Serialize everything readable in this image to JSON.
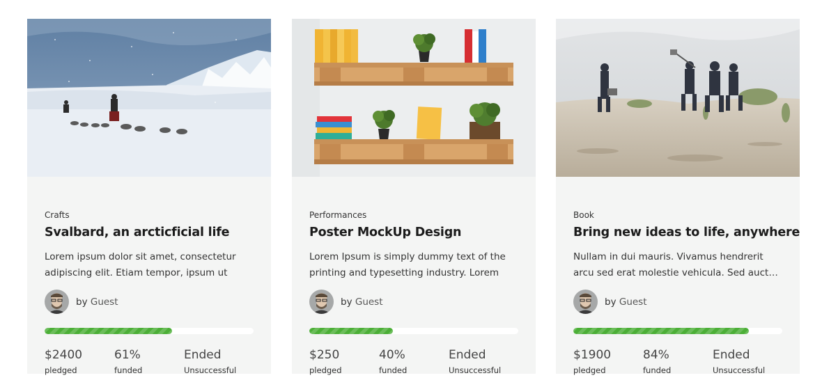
{
  "cards": [
    {
      "image": "dog-sled-snow-landscape",
      "category": "Crafts",
      "title": "Svalbard, an arcticficial life",
      "excerpt": "Lorem ipsum dolor sit amet, consectetur adipiscing elit. Etiam tempor, ipsum ut mattis",
      "author_prefix": "by",
      "author": "Guest",
      "progress_percent": 61,
      "stats": [
        {
          "value": "$2400",
          "label": "pledged"
        },
        {
          "value": "61%",
          "label": "funded"
        },
        {
          "value": "Ended",
          "label": "Unsuccessful"
        }
      ]
    },
    {
      "image": "pallet-shelves-books-plants",
      "category": "Performances",
      "title": "Poster MockUp Design",
      "excerpt": "Lorem Ipsum is simply dummy text of the printing and typesetting industry. Lorem Ipsum",
      "author_prefix": "by",
      "author": "Guest",
      "progress_percent": 40,
      "stats": [
        {
          "value": "$250",
          "label": "pledged"
        },
        {
          "value": "40%",
          "label": "funded"
        },
        {
          "value": "Ended",
          "label": "Unsuccessful"
        }
      ]
    },
    {
      "image": "film-crew-beach-dunes",
      "category": "Book",
      "title": "Bring new ideas to life, anywhere",
      "excerpt": "Nullam in dui mauris. Vivamus hendrerit arcu sed erat molestie vehicula. Sed auctor neque eu...",
      "author_prefix": "by",
      "author": "Guest",
      "progress_percent": 84,
      "stats": [
        {
          "value": "$1900",
          "label": "pledged"
        },
        {
          "value": "84%",
          "label": "funded"
        },
        {
          "value": "Ended",
          "label": "Unsuccessful"
        }
      ]
    }
  ],
  "colors": {
    "card_bg": "#f4f5f4",
    "progress_fill": "#4caf37",
    "progress_track": "#ffffff"
  }
}
